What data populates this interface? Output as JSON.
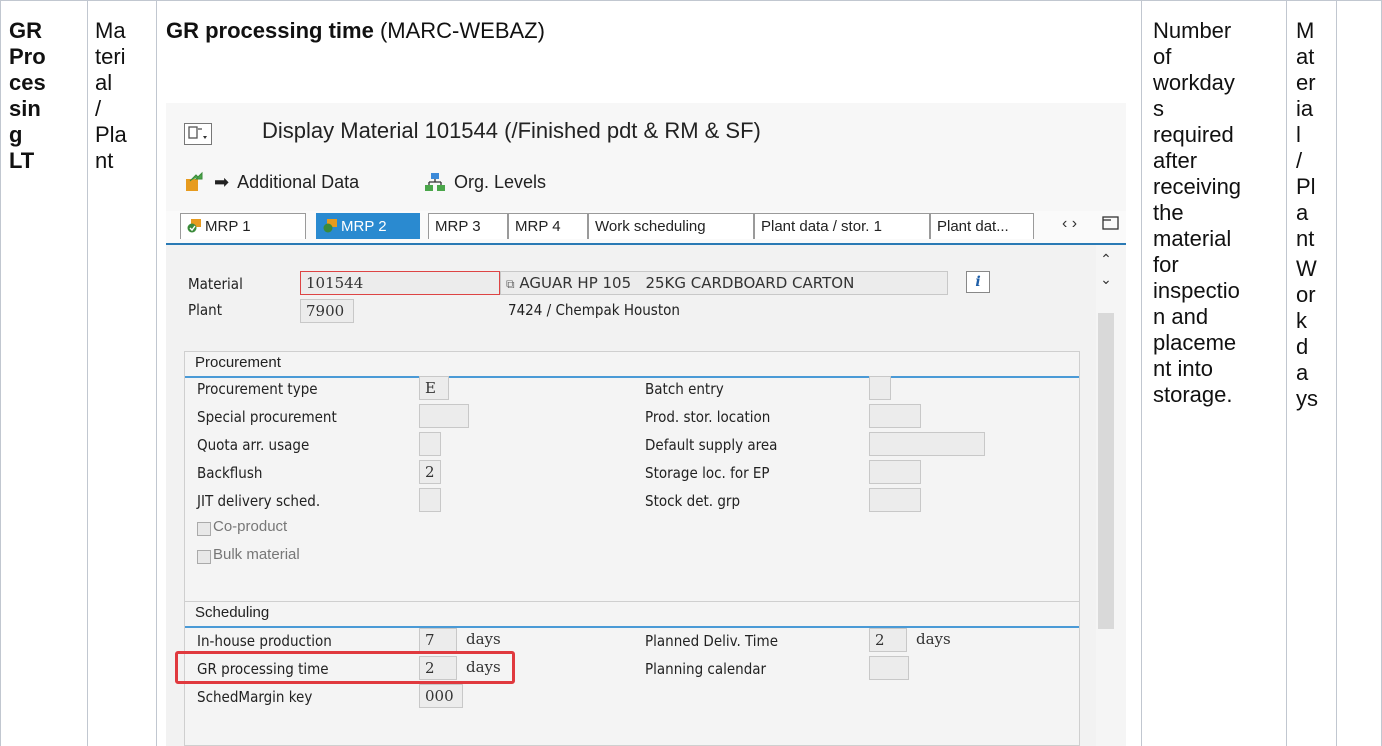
{
  "columns": {
    "name": [
      "GR",
      "Pro",
      "ces",
      "sin",
      "g",
      "LT"
    ],
    "level": [
      "Ma",
      "teri",
      "al",
      "/",
      "Pla",
      "nt"
    ],
    "field_title_bold": "GR processing time",
    "field_title_rest": " (MARC-WEBAZ)",
    "description": [
      "Number",
      "of",
      "workday",
      "s",
      "required",
      "after",
      "receiving",
      "the",
      "material",
      "for",
      "inspectio",
      "n and",
      "placeme",
      "nt into",
      "storage."
    ],
    "data_level": [
      "M",
      "at",
      "er",
      "ia",
      "l",
      "/",
      "Pl",
      "a",
      "nt",
      "W",
      "or",
      "k",
      "d",
      "a",
      "ys"
    ]
  },
  "sap": {
    "title": "Display Material 101544 (/Finished pdt & RM & SF)",
    "toolbar": {
      "additional_data": "Additional Data",
      "org_levels": "Org. Levels"
    },
    "tabs": [
      "MRP 1",
      "MRP 2",
      "MRP 3",
      "MRP 4",
      "Work scheduling",
      "Plant data / stor. 1",
      "Plant dat..."
    ],
    "active_tab": "MRP 2",
    "header": {
      "material_label": "Material",
      "material_value": "101544",
      "material_desc": "AGUAR HP 105   25KG CARDBOARD CARTON",
      "plant_label": "Plant",
      "plant_value": "7900",
      "plant_desc": "7424 / Chempak Houston"
    },
    "procurement": {
      "title": "Procurement",
      "left": [
        {
          "label": "Procurement type",
          "value": "E"
        },
        {
          "label": "Special procurement",
          "value": ""
        },
        {
          "label": "Quota arr. usage",
          "value": ""
        },
        {
          "label": "Backflush",
          "value": "2"
        },
        {
          "label": "JIT delivery sched.",
          "value": ""
        }
      ],
      "right": [
        {
          "label": "Batch entry",
          "value": ""
        },
        {
          "label": "Prod. stor. location",
          "value": ""
        },
        {
          "label": "Default supply area",
          "value": ""
        },
        {
          "label": "Storage loc. for EP",
          "value": ""
        },
        {
          "label": "Stock det. grp",
          "value": ""
        }
      ],
      "checkboxes": [
        "Co-product",
        "Bulk material"
      ]
    },
    "scheduling": {
      "title": "Scheduling",
      "inhouse_label": "In-house production",
      "inhouse_value": "7",
      "inhouse_unit": "days",
      "gr_label": "GR processing time",
      "gr_value": "2",
      "gr_unit": "days",
      "margin_label": "SchedMargin key",
      "margin_value": "000",
      "planned_label": "Planned Deliv. Time",
      "planned_value": "2",
      "planned_unit": "days",
      "calendar_label": "Planning calendar",
      "calendar_value": ""
    },
    "info_button": "i",
    "nav_arrows": "‹ ›"
  }
}
